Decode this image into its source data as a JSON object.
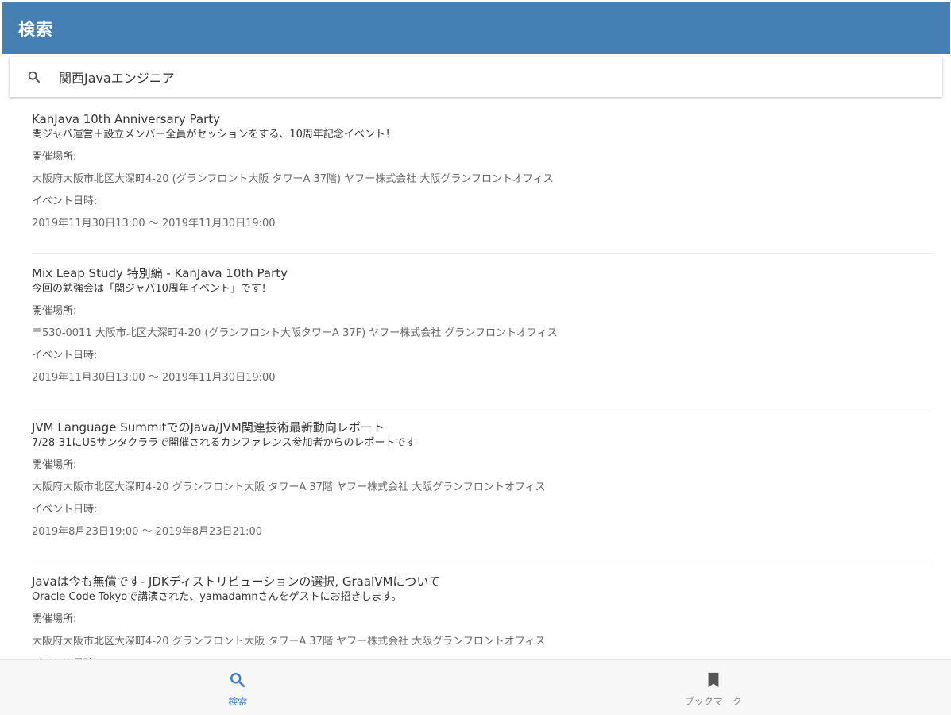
{
  "header": {
    "title": "検索"
  },
  "search": {
    "value": "関西Javaエンジニア",
    "placeholder": ""
  },
  "labels": {
    "venue": "開催場所:",
    "datetime": "イベント日時:"
  },
  "events": [
    {
      "title": "KanJava 10th Anniversary Party",
      "description": "関ジャバ運営＋設立メンバー全員がセッションをする、10周年記念イベント！",
      "venue": "大阪府大阪市北区大深町4-20 (グランフロント大阪 タワーA 37階) ヤフー株式会社 大阪グランフロントオフィス",
      "datetime": "2019年11月30日13:00 ～ 2019年11月30日19:00"
    },
    {
      "title": "Mix Leap Study 特別編 - KanJava 10th Party",
      "description": "今回の勉強会は「関ジャバ10周年イベント」です！",
      "venue": "〒530-0011 大阪市北区大深町4-20 (グランフロント大阪タワーA 37F) ヤフー株式会社 グランフロントオフィス",
      "datetime": "2019年11月30日13:00 ～ 2019年11月30日19:00"
    },
    {
      "title": "JVM Language SummitでのJava/JVM関連技術最新動向レポート",
      "description": "7/28-31にUSサンタクララで開催されるカンファレンス参加者からのレポートです",
      "venue": "大阪府大阪市北区大深町4-20 グランフロント大阪 タワーA 37階 ヤフー株式会社 大阪グランフロントオフィス",
      "datetime": "2019年8月23日19:00 ～ 2019年8月23日21:00"
    },
    {
      "title": "Javaは今も無償です- JDKディストリビューションの選択, GraalVMについて",
      "description": "Oracle Code Tokyoで講演された、yamadamnさんをゲストにお招きします。",
      "venue": "大阪府大阪市北区大深町4-20 グランフロント大阪 タワーA 37階 ヤフー株式会社 大阪グランフロントオフィス",
      "datetime": ""
    }
  ],
  "nav": {
    "tabs": [
      {
        "label": "検索",
        "icon": "search-icon",
        "active": true
      },
      {
        "label": "ブックマーク",
        "icon": "bookmark-icon",
        "active": false
      }
    ]
  },
  "colors": {
    "header_bg": "#4580b5",
    "active_tab": "#3a7bd5",
    "inactive_tab": "#888888"
  }
}
